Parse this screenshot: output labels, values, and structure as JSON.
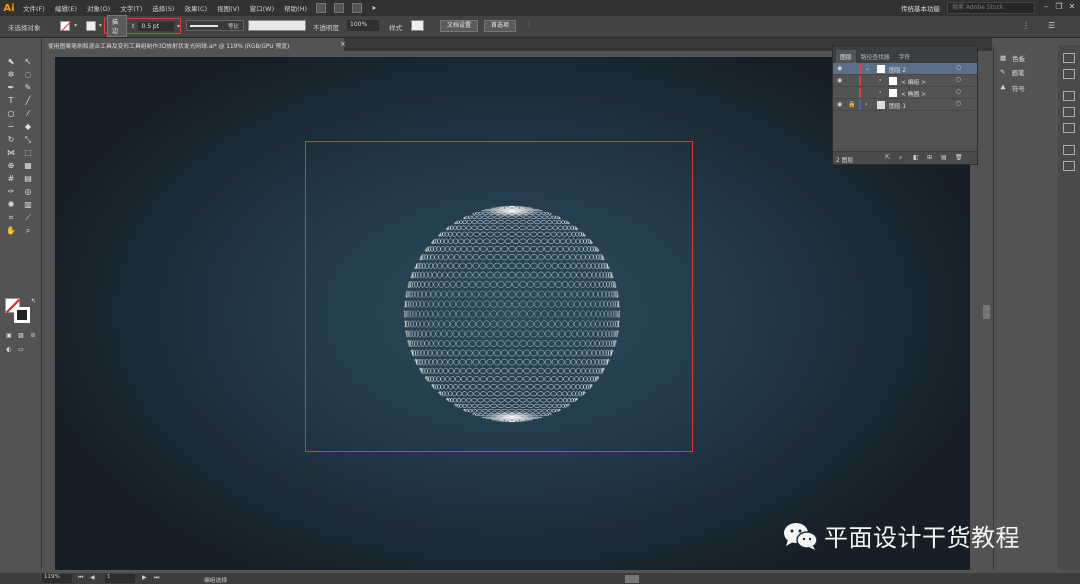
{
  "app": {
    "logo": "Ai"
  },
  "menu": [
    "文件(F)",
    "编辑(E)",
    "对象(O)",
    "文字(T)",
    "选择(S)",
    "效果(C)",
    "视图(V)",
    "窗口(W)",
    "帮助(H)"
  ],
  "workspace": "传统基本功能",
  "search_placeholder": "搜索 Adobe Stock",
  "control": {
    "selection_status": "未选择对象",
    "stroke_label": "描边",
    "stroke_weight": "0.5 pt",
    "profile_label": "等比",
    "opacity_label": "不透明度",
    "opacity_value": "100%",
    "style_label": "样式",
    "doc_setup": "文档设置",
    "preferences": "首选项"
  },
  "document_tab": "使用图案笔刷和混合工具及变形工具组制作3D放射状发光网球.ai* @ 119% (RGB/GPU 预览)",
  "layers_panel": {
    "tabs": [
      "图层",
      "路径查找器",
      "字符"
    ],
    "rows": [
      {
        "name": "图层 2",
        "selected": true,
        "color": "#d94040"
      },
      {
        "name": "< 编组 >",
        "selected": false,
        "color": "#d94040"
      },
      {
        "name": "< 椭圆 >",
        "selected": false,
        "color": "#d94040"
      },
      {
        "name": "图层 1",
        "selected": false,
        "color": "#4060c0"
      }
    ],
    "count": "2 图层"
  },
  "right_dock": [
    {
      "icon": "swatches-icon",
      "label": "色板"
    },
    {
      "icon": "brushes-icon",
      "label": "画笔"
    },
    {
      "icon": "symbols-icon",
      "label": "符号"
    }
  ],
  "status": {
    "zoom": "119%",
    "page": "1",
    "tool": "编组选择"
  },
  "watermark": "平面设计干货教程",
  "colors": {
    "artboard_border": "#e03838",
    "canvas_center": "#2c4b5c",
    "canvas_edge": "#161f28",
    "sphere_lines": "#ffffff"
  }
}
